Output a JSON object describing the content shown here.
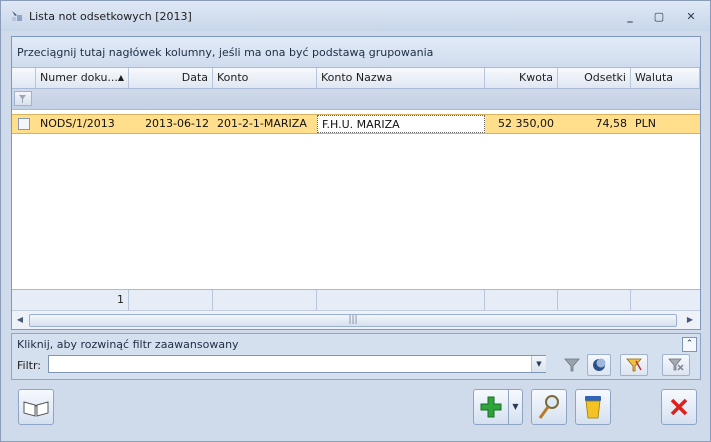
{
  "window": {
    "title": "Lista not odsetkowych [2013]",
    "minimize": "_",
    "restore": "▢",
    "close": "✕"
  },
  "grid": {
    "group_hint": "Przeciągnij tutaj nagłówek kolumny, jeśli ma ona być podstawą grupowania",
    "columns": {
      "numer": "Numer doku...",
      "data": "Data",
      "konto": "Konto",
      "konto_nazwa": "Konto Nazwa",
      "kwota": "Kwota",
      "odsetki": "Odsetki",
      "waluta": "Waluta"
    },
    "sort_indicator": "▲",
    "rows": [
      {
        "numer": "NODS/1/2013",
        "data": "2013-06-12",
        "konto": "201-2-1-MARIZA",
        "konto_nazwa": "F.H.U. MARIZA",
        "kwota": "52 350,00",
        "odsetki": "74,58",
        "waluta": "PLN"
      }
    ],
    "footer_count": "1",
    "scroll_grip": "|||"
  },
  "filter_panel": {
    "expand_link": "Kliknij, aby rozwinąć filtr zaawansowany",
    "label": "Filtr:",
    "value": ""
  },
  "colors": {
    "selected_row": "#ffde8c",
    "window_bg": "#cfdbeb"
  }
}
